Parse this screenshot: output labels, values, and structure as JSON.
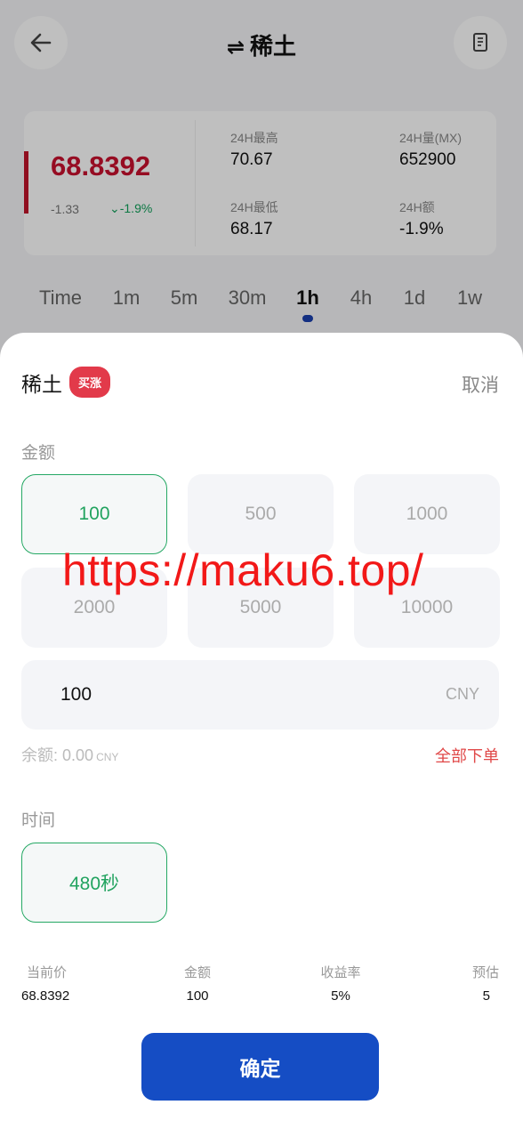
{
  "header": {
    "title": "稀土",
    "swap_icon": "⇌",
    "back_icon": "arrow-left",
    "doc_icon": "document"
  },
  "quote": {
    "price": "68.8392",
    "change_abs": "-1.33",
    "change_pct": "-1.9%",
    "high_label": "24H最高",
    "high_value": "70.67",
    "low_label": "24H最低",
    "low_value": "68.17",
    "vol_label": "24H量(MX)",
    "vol_value": "652900",
    "amt_label": "24H额",
    "amt_value": "-1.9%"
  },
  "periods": [
    "Time",
    "1m",
    "5m",
    "30m",
    "1h",
    "4h",
    "1d",
    "1w"
  ],
  "active_period": "1h",
  "sheet": {
    "name": "稀土",
    "badge": "买涨",
    "cancel": "取消",
    "amount_label": "金额",
    "amounts": [
      "100",
      "500",
      "1000",
      "2000",
      "5000",
      "10000"
    ],
    "selected_amount": "100",
    "input_value": "100",
    "input_unit": "CNY",
    "balance_label": "余额:",
    "balance_value": "0.00",
    "balance_unit": "CNY",
    "order_all": "全部下单",
    "time_label": "时间",
    "time_option": "480秒",
    "summary": {
      "price_label": "当前价",
      "price_value": "68.8392",
      "amount_label": "金额",
      "amount_value": "100",
      "rate_label": "收益率",
      "rate_value": "5%",
      "est_label": "预估",
      "est_value": "5"
    },
    "confirm": "确定"
  },
  "watermark": "https://maku6.top/",
  "colors": {
    "accent_blue": "#154dc4",
    "up_green": "#21a35f",
    "down_red": "#c8102e",
    "badge_red": "#e23a4a"
  }
}
